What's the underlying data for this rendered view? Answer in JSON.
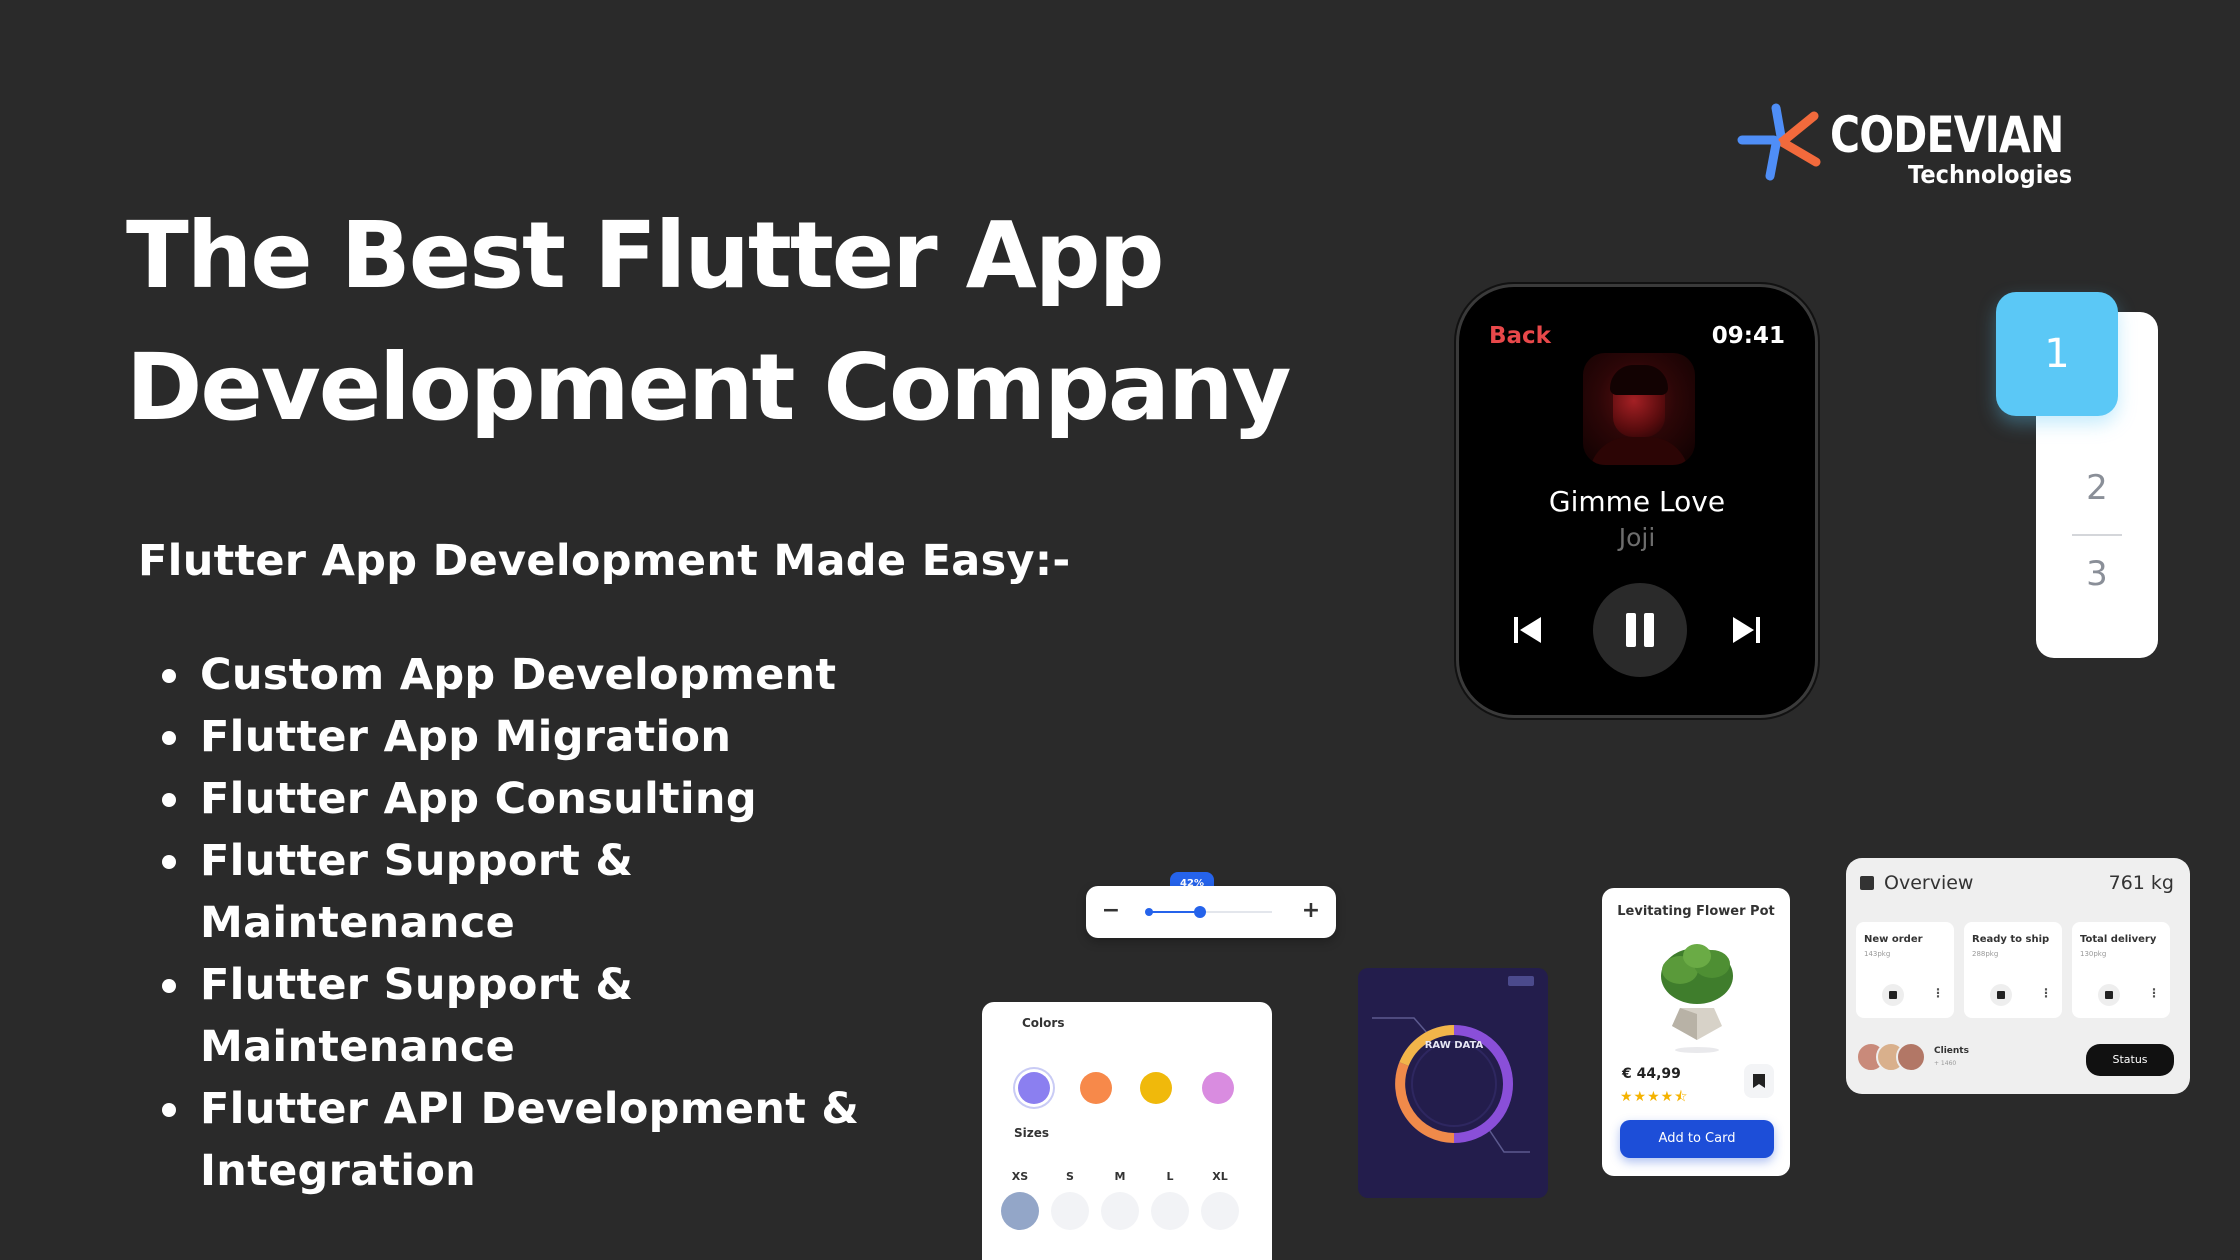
{
  "logo": {
    "name": "CODEVIAN",
    "subtitle": "Technologies"
  },
  "hero": {
    "title_line1": "The Best Flutter App",
    "title_line2": "Development Company",
    "subheading": "Flutter App Development Made Easy:-"
  },
  "features": [
    "Custom App Development",
    "Flutter App Migration",
    "Flutter App Consulting",
    "Flutter Support & Maintenance",
    "Flutter Support & Maintenance",
    "Flutter API Development &",
    "Integration"
  ],
  "watch": {
    "back_label": "Back",
    "time": "09:41",
    "song": "Gimme Love",
    "artist": "Joji"
  },
  "picker": {
    "selected": "1",
    "options": [
      "2",
      "3"
    ]
  },
  "stepper": {
    "value_label": "42%",
    "value": 0.42,
    "minus": "−",
    "plus": "+"
  },
  "options_card": {
    "colors_label": "Colors",
    "sizes_label": "Sizes",
    "colors": [
      "#8b7ff0",
      "#f7894a",
      "#f0b90b",
      "#d98ce0"
    ],
    "sizes": [
      "XS",
      "S",
      "M",
      "L",
      "XL"
    ]
  },
  "raw_card": {
    "label": "RAW DATA"
  },
  "product": {
    "title": "Levitating Flower Pot",
    "price": "€ 44,99",
    "rating": 4.5,
    "button": "Add to Card"
  },
  "overview": {
    "title": "Overview",
    "total": "761 kg",
    "tiles": [
      {
        "title": "New order",
        "sub": "143pkg"
      },
      {
        "title": "Ready to ship",
        "sub": "288pkg"
      },
      {
        "title": "Total delivery",
        "sub": "130pkg"
      }
    ],
    "clients": "Clients",
    "clients_sub": "+ 1460",
    "status_button": "Status"
  },
  "colors": {
    "background": "#2a2a2a",
    "accent_blue": "#2563eb",
    "picker_blue": "#5bc8f6",
    "watch_red": "#e8484a"
  }
}
